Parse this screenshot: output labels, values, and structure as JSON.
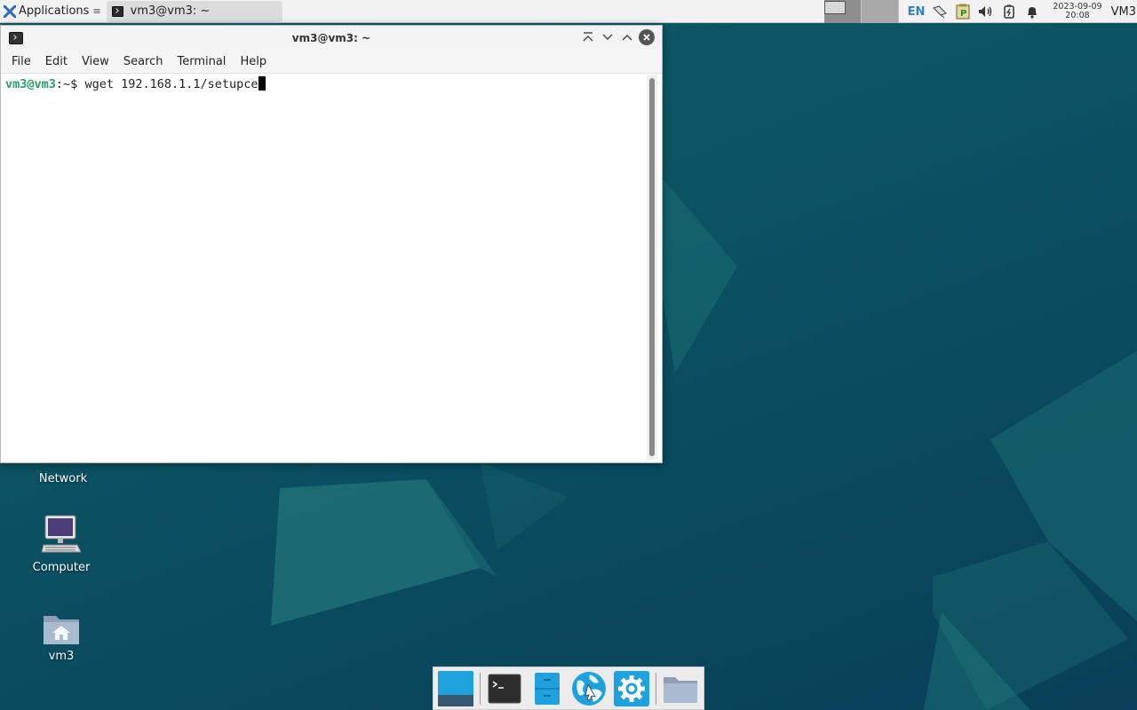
{
  "top_panel": {
    "applications_label": "Applications",
    "menu_glyph": "≡",
    "task_title": "vm3@vm3: ~",
    "language": "EN",
    "clock_date": "2023-09-09",
    "clock_time": "20:08",
    "user_label": "VM3",
    "tray_icons": [
      "network-icon",
      "clipboard-icon",
      "volume-icon",
      "battery-icon",
      "notification-bell-icon"
    ]
  },
  "terminal": {
    "title": "vm3@vm3: ~",
    "menu": [
      "File",
      "Edit",
      "View",
      "Search",
      "Terminal",
      "Help"
    ],
    "prompt_user": "vm3@vm3",
    "prompt_path": ":~",
    "prompt_symbol": "$ ",
    "command": "wget 192.168.1.1/setupce"
  },
  "desktop_icons": {
    "network": "Network",
    "computer": "Computer",
    "home": "vm3"
  },
  "dock": {
    "items": [
      "show-desktop-icon",
      "terminal-icon",
      "file-manager-icon",
      "web-browser-icon",
      "settings-icon",
      "folder-icon"
    ]
  },
  "colors": {
    "prompt_user": "#26a269",
    "accent": "#2c82c9",
    "desktop": "#0c5563"
  }
}
